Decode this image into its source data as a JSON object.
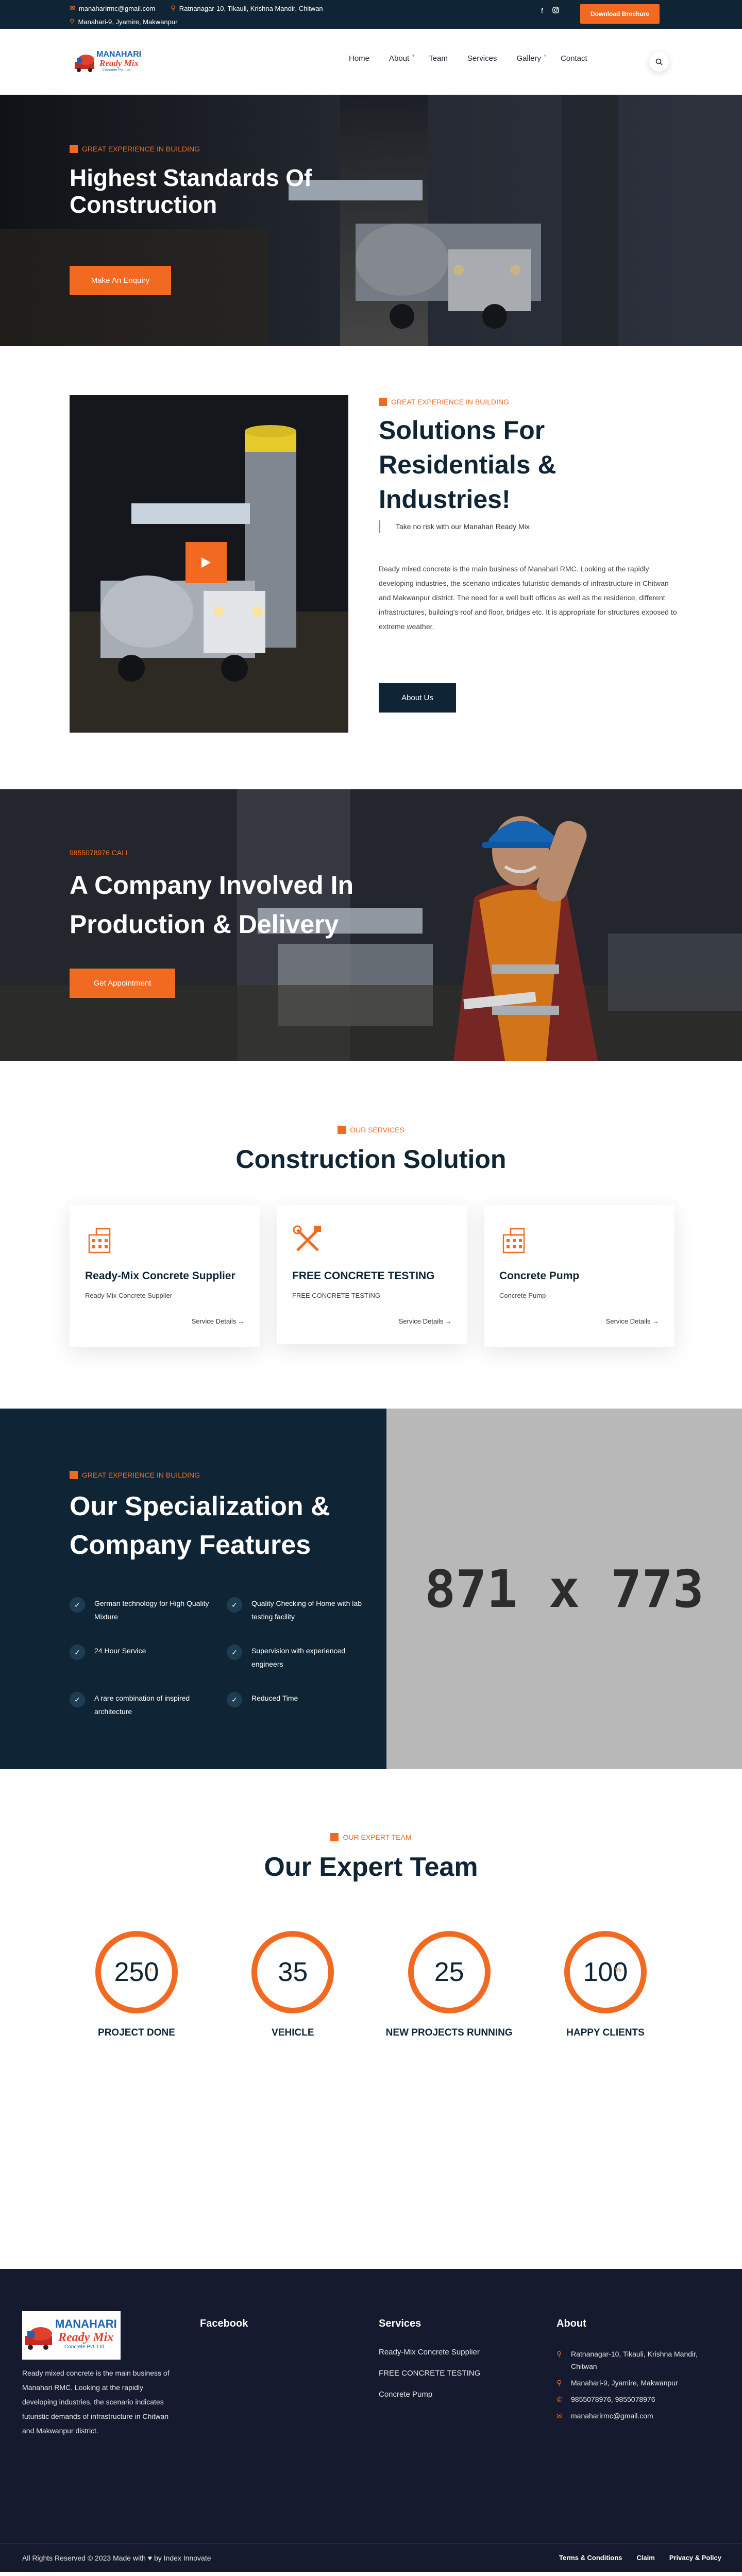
{
  "topbar": {
    "email": "manaharirmc@gmail.com",
    "address1": "Ratnanagar-10, Tikauli, Krishna Mandir, Chitwan",
    "address2": "Manahari-9, Jyamire, Makwanpur",
    "download_label": "Download Brochure",
    "social": [
      "f",
      "ig"
    ]
  },
  "logo": {
    "line1": "MANAHARI",
    "line2": "Ready Mix",
    "line3": "Concrete Pvt. Ltd."
  },
  "nav": {
    "items": [
      {
        "label": "Home",
        "has_sub": false
      },
      {
        "label": "About",
        "has_sub": true
      },
      {
        "label": "Team",
        "has_sub": false
      },
      {
        "label": "Services",
        "has_sub": false
      },
      {
        "label": "Gallery",
        "has_sub": true
      },
      {
        "label": "Contact",
        "has_sub": false
      }
    ]
  },
  "hero": {
    "tag": "GREAT EXPERIENCE IN BUILDING",
    "title": "Highest Standards Of Construction",
    "button": "Make An Enquiry"
  },
  "about": {
    "tag": "GREAT EXPERIENCE IN BUILDING",
    "title": "Solutions For Residentials & Industries!",
    "note": "Take no risk with our Manahari Ready Mix",
    "description": "Ready mixed concrete is the main business of Manahari RMC. Looking at the rapidly developing industries, the scenario indicates futuristic demands of infrastructure in Chitwan and Makwanpur district. The need for a well built offices as well as the residence, different infrastructures, building's roof and floor, bridges etc. It is appropriate for structures exposed to extreme weather.",
    "button": "About Us"
  },
  "cta": {
    "tag": "9855078976 CALL",
    "title": "A Company Involved In Production & Delivery",
    "button": "Get Appointment"
  },
  "services": {
    "tag": "OUR SERVICES",
    "title": "Construction Solution",
    "cards": [
      {
        "title": "Ready-Mix Concrete Supplier",
        "text": "Ready Mix Concrete Supplier",
        "link": "Service Details →",
        "icon": "building-icon"
      },
      {
        "title": "FREE CONCRETE TESTING",
        "text": "FREE CONCRETE TESTING",
        "link": "Service Details →",
        "icon": "tools-icon"
      },
      {
        "title": "Concrete Pump",
        "text": "Concrete Pump",
        "link": "Service Details →",
        "icon": "building-icon"
      }
    ]
  },
  "features": {
    "tag": "GREAT EXPERIENCE IN BUILDING",
    "title": "Our Specialization & Company Features",
    "items": [
      "German technology for High Quality Mixture",
      "Quality Checking of Home with lab testing facility",
      "24 Hour Service",
      "Supervision with experienced engineers",
      "A rare combination of inspired architecture",
      "Reduced Time"
    ],
    "placeholder": "871 x 773"
  },
  "team": {
    "tag": "OUR EXPERT TEAM",
    "title": "Our Expert Team",
    "stats": [
      {
        "value": "250",
        "suffix": "+",
        "label": "PROJECT DONE"
      },
      {
        "value": "35",
        "suffix": "",
        "label": "VEHICLE"
      },
      {
        "value": "25",
        "suffix": "+",
        "label": "NEW PROJECTS RUNNING"
      },
      {
        "value": "100",
        "suffix": "%",
        "label": "HAPPY CLIENTS"
      }
    ]
  },
  "footer": {
    "description": "Ready mixed concrete is the main business of Manahari RMC. Looking at the rapidly developing industries, the scenario indicates futuristic demands of infrastructure in Chitwan and Makwanpur district.",
    "facebook_heading": "Facebook",
    "services_heading": "Services",
    "services": [
      "Ready-Mix Concrete Supplier",
      "FREE CONCRETE TESTING",
      "Concrete Pump"
    ],
    "about_heading": "About",
    "contact": [
      {
        "icon": "pin-icon",
        "text": "Ratnanagar-10, Tikauli, Krishna Mandir, Chitwan"
      },
      {
        "icon": "pin-icon",
        "text": "Manahari-9, Jyamire, Makwanpur"
      },
      {
        "icon": "phone-icon",
        "text": "9855078976, 9855078976"
      },
      {
        "icon": "mail-icon",
        "text": "manaharirmc@gmail.com"
      }
    ],
    "copyright": "All Rights Reserved © 2023 Made with ♥ by Index Innovate",
    "links": [
      "Terms & Conditions",
      "Claim",
      "Privacy & Policy"
    ]
  },
  "colors": {
    "accent": "#f26a21",
    "navy": "#0f2535",
    "footer": "#151a2e"
  }
}
